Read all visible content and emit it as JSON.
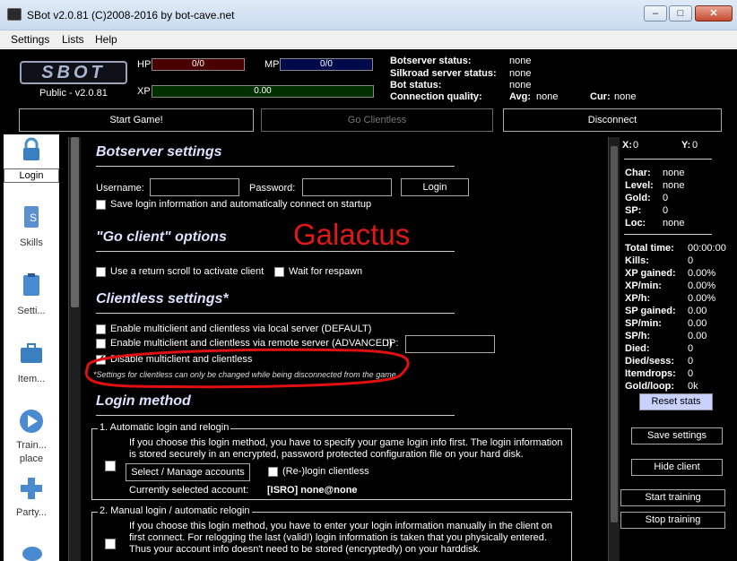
{
  "window": {
    "title": "SBot v2.0.81 (C)2008-2016 by bot-cave.net",
    "minimize": "–",
    "maximize": "□",
    "close": "✕"
  },
  "menu": [
    "Settings",
    "Lists",
    "Help"
  ],
  "header": {
    "logo": "SBOT",
    "version": "Public - v2.0.81",
    "hp_label": "HP",
    "hp_value": "0/0",
    "mp_label": "MP",
    "mp_value": "0/0",
    "xp_label": "XP",
    "xp_value": "0.00",
    "status": [
      {
        "label": "Botserver status:",
        "value": "none"
      },
      {
        "label": "Silkroad server status:",
        "value": "none"
      },
      {
        "label": "Bot status:",
        "value": "none"
      },
      {
        "label": "Connection quality:",
        "value": ""
      }
    ],
    "avg_label": "Avg:",
    "avg_value": "none",
    "cur_label": "Cur:",
    "cur_value": "none"
  },
  "actions": {
    "start_game": "Start Game!",
    "go_clientless": "Go Clientless",
    "disconnect": "Disconnect"
  },
  "nav": [
    {
      "label": "Login"
    },
    {
      "label": "Skills"
    },
    {
      "label": "Setti..."
    },
    {
      "label": "Item..."
    },
    {
      "label": "Train... place"
    },
    {
      "label": "Party..."
    }
  ],
  "botserver": {
    "title": "Botserver settings",
    "username_label": "Username:",
    "password_label": "Password:",
    "login_button": "Login",
    "save_login": "Save login information and automatically connect on startup"
  },
  "overlay_text": "Galactus",
  "goclient": {
    "title": "\"Go client\" options",
    "return_scroll": "Use a return scroll to activate client",
    "wait_respawn": "Wait for respawn"
  },
  "clientless": {
    "title": "Clientless settings*",
    "opt_local": "Enable multiclient and clientless via local server (DEFAULT)",
    "opt_remote": "Enable multiclient and clientless via remote server (ADVANCED)",
    "ip_label": "IP:",
    "opt_disable": "Disable multiclient and clientless",
    "note": "*Settings for clientless can only be changed while being disconnected from the game."
  },
  "login_method": {
    "title": "Login method",
    "auto": {
      "legend": "1. Automatic login and relogin",
      "desc1": "If you choose this login method, you have to specify your game login info first. The login information",
      "desc2": "is stored securely in an encrypted, password protected configuration file on your hard disk.",
      "manage_button": "Select / Manage accounts",
      "relogin": "(Re-)login clientless",
      "current_label": "Currently selected account:",
      "current_value": "[ISRO] none@none"
    },
    "manual": {
      "legend": "2. Manual login / automatic relogin",
      "desc1": "If you choose this login method, you have to enter your login information manually in the client on",
      "desc2": "first connect. For relogging the last (valid!) login information is taken that you physically entered.",
      "desc3": "Thus your account info doesn't need to be stored (encryptedly) on your harddisk."
    }
  },
  "stats": {
    "x_label": "X:",
    "x_value": "0",
    "y_label": "Y:",
    "y_value": "0",
    "char": [
      {
        "label": "Char:",
        "value": "none"
      },
      {
        "label": "Level:",
        "value": "none"
      },
      {
        "label": "Gold:",
        "value": "0"
      },
      {
        "label": "SP:",
        "value": "0"
      },
      {
        "label": "Loc:",
        "value": "none"
      }
    ],
    "training": [
      {
        "label": "Total time:",
        "value": "00:00:00"
      },
      {
        "label": "Kills:",
        "value": "0"
      },
      {
        "label": "XP gained:",
        "value": "0.00%"
      },
      {
        "label": "XP/min:",
        "value": "0.00%"
      },
      {
        "label": "XP/h:",
        "value": "0.00%"
      },
      {
        "label": "SP gained:",
        "value": "0.00"
      },
      {
        "label": "SP/min:",
        "value": "0.00"
      },
      {
        "label": "SP/h:",
        "value": "0.00"
      },
      {
        "label": "Died:",
        "value": "0"
      },
      {
        "label": "Died/sess:",
        "value": "0"
      },
      {
        "label": "Itemdrops:",
        "value": "0"
      },
      {
        "label": "Gold/loop:",
        "value": "0k"
      }
    ],
    "reset": "Reset stats",
    "save": "Save settings",
    "hide": "Hide client",
    "start": "Start training",
    "stop": "Stop training"
  },
  "colors": {
    "hp": "#4a0000",
    "mp": "#000a4a",
    "xp": "#003000",
    "annotation": "#e01010",
    "galactus": "#e01818",
    "section": "#dce3ff"
  }
}
